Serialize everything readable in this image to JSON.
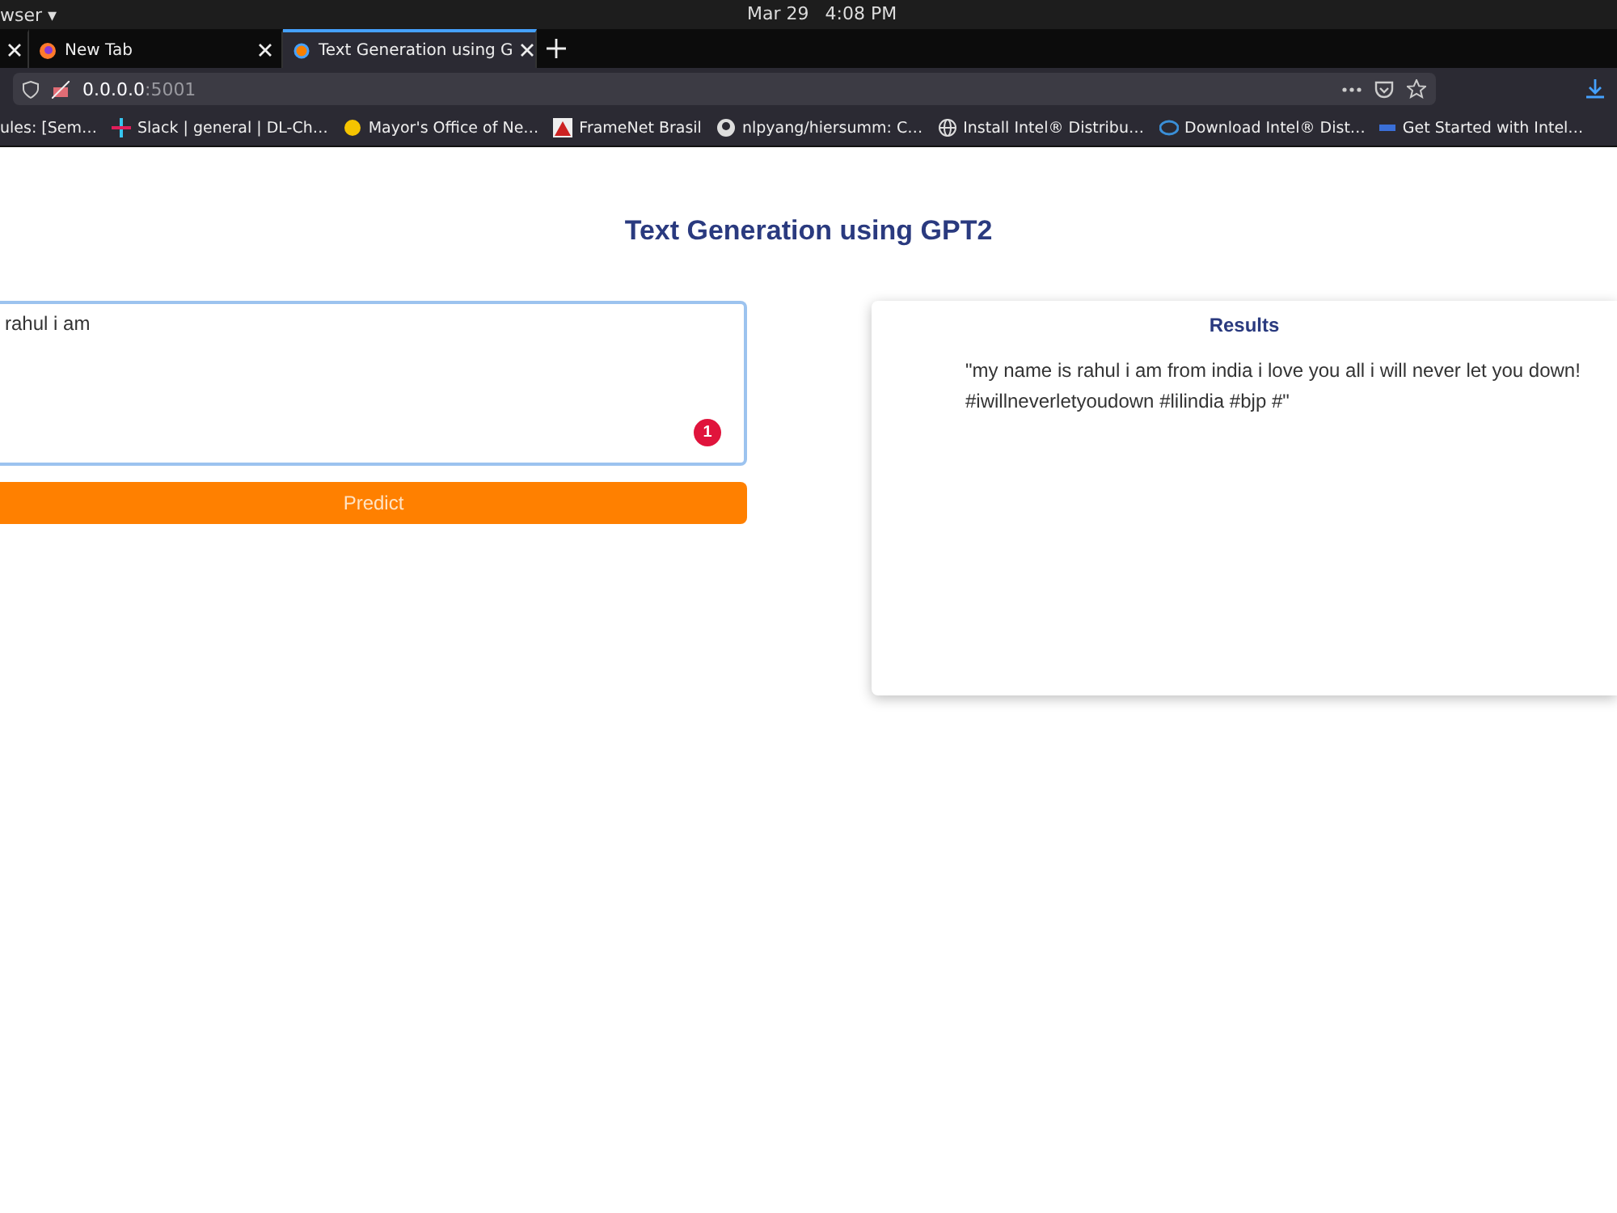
{
  "system_bar": {
    "app_menu": "wser ▾",
    "date": "Mar 29",
    "time": "4:08 PM"
  },
  "tabs": [
    {
      "selected": false,
      "kind": "stub"
    },
    {
      "label": "New Tab",
      "selected": false,
      "kind": "normal"
    },
    {
      "label": "Text Generation using G",
      "selected": true,
      "kind": "normal"
    }
  ],
  "address_bar": {
    "host": "0.0.0.0",
    "port": ":5001"
  },
  "bookmarks": [
    {
      "label": "ules: [Sem…"
    },
    {
      "label": "Slack | general | DL-Ch…"
    },
    {
      "label": "Mayor's Office of Ne…"
    },
    {
      "label": "FrameNet Brasil"
    },
    {
      "label": "nlpyang/hiersumm: C…"
    },
    {
      "label": "Install Intel® Distribu…"
    },
    {
      "label": "Download Intel® Dist…"
    },
    {
      "label": "Get Started with Intel…"
    }
  ],
  "page": {
    "title": "Text Generation using GPT2",
    "input": {
      "value": "rahul i am",
      "badge": "1"
    },
    "predict_button": "Predict",
    "results": {
      "heading": "Results",
      "text": "\"my name is rahul i am from india i love you all i will never let you down! #iwillneverletyoudown #lilindia #bjp #\""
    }
  }
}
